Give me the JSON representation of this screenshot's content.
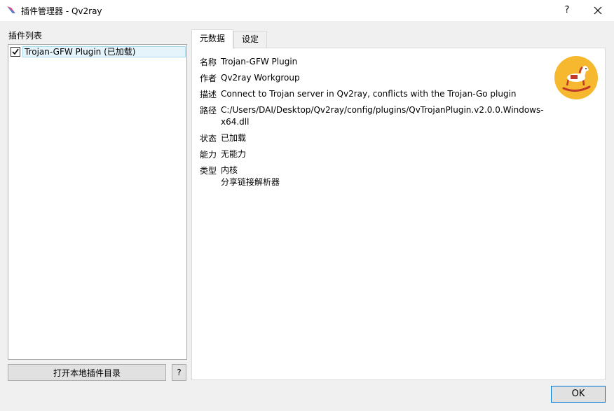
{
  "window": {
    "title": "插件管理器 - Qv2ray",
    "help": "?"
  },
  "left": {
    "list_title": "插件列表",
    "items": [
      {
        "label": "Trojan-GFW Plugin (已加载)",
        "checked": true
      }
    ],
    "open_dir_button": "打开本地插件目录",
    "help_button": "?"
  },
  "tabs": [
    {
      "label": "元数据",
      "active": true
    },
    {
      "label": "设定",
      "active": false
    }
  ],
  "metadata": {
    "name_key": "名称",
    "name": "Trojan-GFW Plugin",
    "author_key": "作者",
    "author": "Qv2ray Workgroup",
    "desc_key": "描述",
    "desc": "Connect to Trojan server in Qv2ray, conflicts with the Trojan-Go plugin",
    "path_key": "路径",
    "path_line1": "C:/Users/DAI/Desktop/Qv2ray/config/plugins/QvTrojanPlugin.v2.0.0.Windows-",
    "path_line2": "x64.dll",
    "status_key": "状态",
    "status": "已加载",
    "cap_key": "能力",
    "cap": "无能力",
    "type_key": "类型",
    "type_line1": "内核",
    "type_line2": "分享链接解析器"
  },
  "footer": {
    "ok_button": "OK"
  },
  "colors": {
    "accent": "#0078d7",
    "selection_bg": "#e5f3fb",
    "avatar_bg": "#f5b82e"
  },
  "icons": {
    "app": "qv2ray-feather-icon",
    "close": "close-icon",
    "avatar": "rocking-horse-icon",
    "check": "check-icon"
  }
}
